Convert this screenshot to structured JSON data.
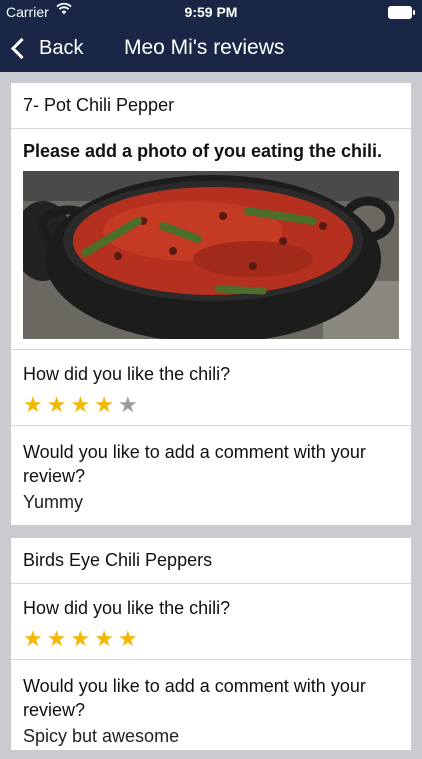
{
  "status": {
    "carrier": "Carrier",
    "wifi_icon": "wifi-icon",
    "time": "9:59 PM",
    "battery_icon": "battery-icon"
  },
  "nav": {
    "back_label": "Back",
    "title": "Meo  Mi's reviews"
  },
  "reviews": [
    {
      "name": "7- Pot Chili Pepper",
      "photo_prompt": "Please add a photo of you eating the chili.",
      "rating_question": "How did you like the chili?",
      "rating": 4,
      "rating_max": 5,
      "comment_question": "Would you like to add a comment with your review?",
      "comment": "Yummy"
    },
    {
      "name": "Birds Eye Chili Peppers",
      "rating_question": "How did you like the chili?",
      "rating": 5,
      "rating_max": 5,
      "comment_question": "Would you like to add a comment with your review?",
      "comment": "Spicy but awesome"
    }
  ],
  "colors": {
    "nav_bg": "#1a2646",
    "star_on": "#f5b800",
    "star_off": "#9b9b9b",
    "page_bg": "#c9cbd1"
  }
}
